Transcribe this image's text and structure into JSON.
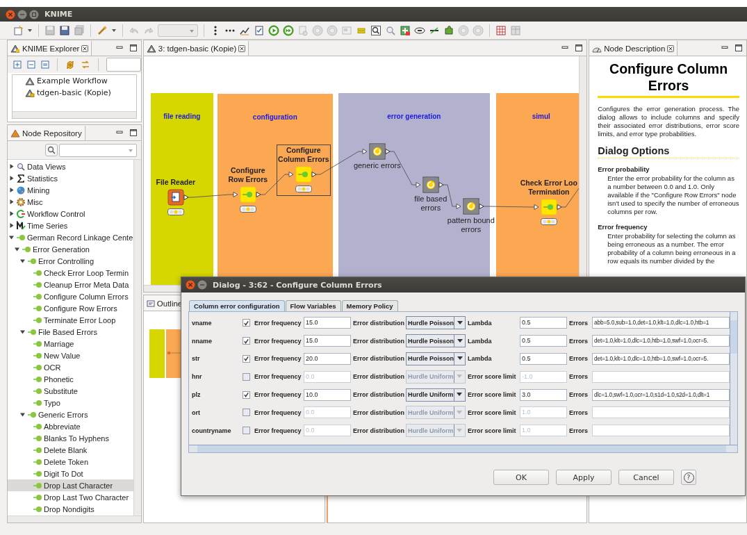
{
  "window": {
    "title": "KNIME"
  },
  "explorer": {
    "title": "KNIME Explorer",
    "items": [
      {
        "label": "Example Workflow",
        "kind": "workflow",
        "selected": false
      },
      {
        "label": "tdgen-basic (Kopie)",
        "kind": "open-workflow",
        "selected": false
      }
    ]
  },
  "repository": {
    "title": "Node Repository",
    "items": [
      {
        "label": "Data Views",
        "kind": "category",
        "expanded": false,
        "selected": false
      },
      {
        "label": "Statistics",
        "kind": "category",
        "expanded": false,
        "selected": false
      },
      {
        "label": "Mining",
        "kind": "category",
        "expanded": false,
        "selected": false
      },
      {
        "label": "Misc",
        "kind": "category",
        "expanded": false,
        "selected": false
      },
      {
        "label": "Workflow Control",
        "kind": "category",
        "expanded": false,
        "selected": false
      },
      {
        "label": "Time Series",
        "kind": "category",
        "expanded": false,
        "selected": false
      },
      {
        "label": "German Record Linkage Cente",
        "kind": "group",
        "expanded": true,
        "selected": false,
        "children": [
          {
            "label": "Error Generation",
            "kind": "group",
            "expanded": true,
            "selected": false,
            "children": [
              {
                "label": "Error Controlling",
                "kind": "group",
                "expanded": true,
                "selected": false,
                "children": [
                  {
                    "label": "Check Error Loop Termin",
                    "kind": "node",
                    "selected": false
                  },
                  {
                    "label": "Cleanup Error Meta Data",
                    "kind": "node",
                    "selected": false
                  },
                  {
                    "label": "Configure Column Errors",
                    "kind": "node",
                    "selected": false
                  },
                  {
                    "label": "Configure Row Errors",
                    "kind": "node",
                    "selected": false
                  },
                  {
                    "label": "Terminate Error Loop",
                    "kind": "node",
                    "selected": false
                  }
                ]
              },
              {
                "label": "File Based Errors",
                "kind": "group",
                "expanded": true,
                "selected": false,
                "children": [
                  {
                    "label": "Marriage",
                    "kind": "node",
                    "selected": false
                  },
                  {
                    "label": "New Value",
                    "kind": "node",
                    "selected": false
                  },
                  {
                    "label": "OCR",
                    "kind": "node",
                    "selected": false
                  },
                  {
                    "label": "Phonetic",
                    "kind": "node",
                    "selected": false
                  },
                  {
                    "label": "Substitute",
                    "kind": "node",
                    "selected": false
                  },
                  {
                    "label": "Typo",
                    "kind": "node",
                    "selected": false
                  }
                ]
              },
              {
                "label": "Generic Errors",
                "kind": "group",
                "expanded": true,
                "selected": false,
                "children": [
                  {
                    "label": "Abbreviate",
                    "kind": "node",
                    "selected": false
                  },
                  {
                    "label": "Blanks To Hyphens",
                    "kind": "node",
                    "selected": false
                  },
                  {
                    "label": "Delete Blank",
                    "kind": "node",
                    "selected": false
                  },
                  {
                    "label": "Delete Token",
                    "kind": "node",
                    "selected": false
                  },
                  {
                    "label": "Digit To Dot",
                    "kind": "node",
                    "selected": false
                  },
                  {
                    "label": "Drop Last Character",
                    "kind": "node",
                    "selected": true
                  },
                  {
                    "label": "Drop Last Two Character",
                    "kind": "node",
                    "selected": false
                  },
                  {
                    "label": "Drop Nondigits",
                    "kind": "node",
                    "selected": false
                  }
                ]
              }
            ]
          }
        ]
      }
    ]
  },
  "editor": {
    "tab": "3: tdgen-basic (Kopie)",
    "annotations": [
      {
        "label": "file reading",
        "color": "#d6d600"
      },
      {
        "label": "configuration",
        "color": "#fca853"
      },
      {
        "label": "error generation",
        "color": "#b2b2cf"
      },
      {
        "label": "simul",
        "color": "#fca853"
      }
    ],
    "nodes": [
      {
        "label": "File Reader",
        "kind": "source",
        "selected": false
      },
      {
        "label": "Configure\nRow Errors",
        "kind": "manipulator",
        "selected": false
      },
      {
        "label": "Configure\nColumn Errors",
        "kind": "manipulator",
        "selected": true
      },
      {
        "label": "generic errors",
        "kind": "metanode",
        "selected": false
      },
      {
        "label": "file based\nerrors",
        "kind": "metanode",
        "selected": false
      },
      {
        "label": "pattern bound\nerrors",
        "kind": "metanode",
        "selected": false
      },
      {
        "label": "Check Error Loo\nTermination",
        "kind": "manipulator",
        "selected": false
      }
    ]
  },
  "outline": {
    "title": "Outline"
  },
  "description": {
    "tab": "Node Description",
    "title": "Configure Column Errors",
    "intro": "Configures the error generation process. The dialog allows to include columns and specify their associated error distributions, error score limits, and error type probabilities.",
    "section": "Dialog Options",
    "options": [
      {
        "name": "Error probability",
        "text": "Enter the error probability for the column as a number between 0.0 and 1.0. Only available if the \"Configure Row Errors\" node isn't used to specify the number of erroneous columns per row."
      },
      {
        "name": "Error frequency",
        "text": "Enter probability for selecting the column as being erroneous as a number. The error probability of a column being erroneous in a row equals its number divided by the"
      }
    ]
  },
  "dialog": {
    "title": "Dialog - 3:62 - Configure Column Errors",
    "tabs": [
      {
        "label": "Column error configuration",
        "selected": true
      },
      {
        "label": "Flow Variables",
        "selected": false
      },
      {
        "label": "Memory Policy",
        "selected": false
      }
    ],
    "rows": [
      {
        "column": "vname",
        "checked": true,
        "frequency_label": "Error frequency",
        "frequency": "15.0",
        "distribution_label": "Error distribution",
        "distribution": "Hurdle Poisson",
        "parameter": "Lambda",
        "parameter_value": "0.5",
        "errors_label": "Errors",
        "errors": "abb=5.0,sub=1.0,det=1.0,klt=1.0,dlc=1.0,htb=1"
      },
      {
        "column": "nname",
        "checked": true,
        "frequency_label": "Error frequency",
        "frequency": "15.0",
        "distribution_label": "Error distribution",
        "distribution": "Hurdle Poisson",
        "parameter": "Lambda",
        "parameter_value": "0.5",
        "errors_label": "Errors",
        "errors": "det=1.0,klt=1.0,dlc=1.0,htb=1.0,swf=1.0,ocr=5."
      },
      {
        "column": "str",
        "checked": true,
        "frequency_label": "Error frequency",
        "frequency": "20.0",
        "distribution_label": "Error distribution",
        "distribution": "Hurdle Poisson",
        "parameter": "Lambda",
        "parameter_value": "0.5",
        "errors_label": "Errors",
        "errors": "det=1.0,klt=1.0,dlc=1.0,htb=1.0,swf=1.0,ocr=5."
      },
      {
        "column": "hnr",
        "checked": false,
        "frequency_label": "Error frequency",
        "frequency": "0.0",
        "distribution_label": "Error distribution",
        "distribution": "Hurdle Uniform",
        "parameter": "Error score limit",
        "parameter_value": "-1.0",
        "errors_label": "Errors"
      },
      {
        "column": "plz",
        "checked": true,
        "frequency_label": "Error frequency",
        "frequency": "10.0",
        "distribution_label": "Error distribution",
        "distribution": "Hurdle Uniform",
        "parameter": "Error score limit",
        "parameter_value": "3.0",
        "errors_label": "Errors",
        "errors": "dlc=1.0,swf=1.0,ocr=1.0,s1d=1.0,s2d=1.0,dlt=1"
      },
      {
        "column": "ort",
        "checked": false,
        "frequency_label": "Error frequency",
        "frequency": "0.0",
        "distribution_label": "Error distribution",
        "distribution": "Hurdle Uniform",
        "parameter": "Error score limit",
        "parameter_value": "1.0",
        "errors_label": "Errors"
      },
      {
        "column": "countryname",
        "checked": false,
        "frequency_label": "Error frequency",
        "frequency": "0.0",
        "distribution_label": "Error distribution",
        "distribution": "Hurdle Uniform",
        "parameter": "Error score limit",
        "parameter_value": "1.0",
        "errors_label": "Errors"
      }
    ],
    "buttons": [
      {
        "label": "OK",
        "kind": "text"
      },
      {
        "label": "Apply",
        "kind": "text"
      },
      {
        "label": "Cancel",
        "kind": "text"
      },
      {
        "label": "?",
        "kind": "help"
      }
    ]
  }
}
